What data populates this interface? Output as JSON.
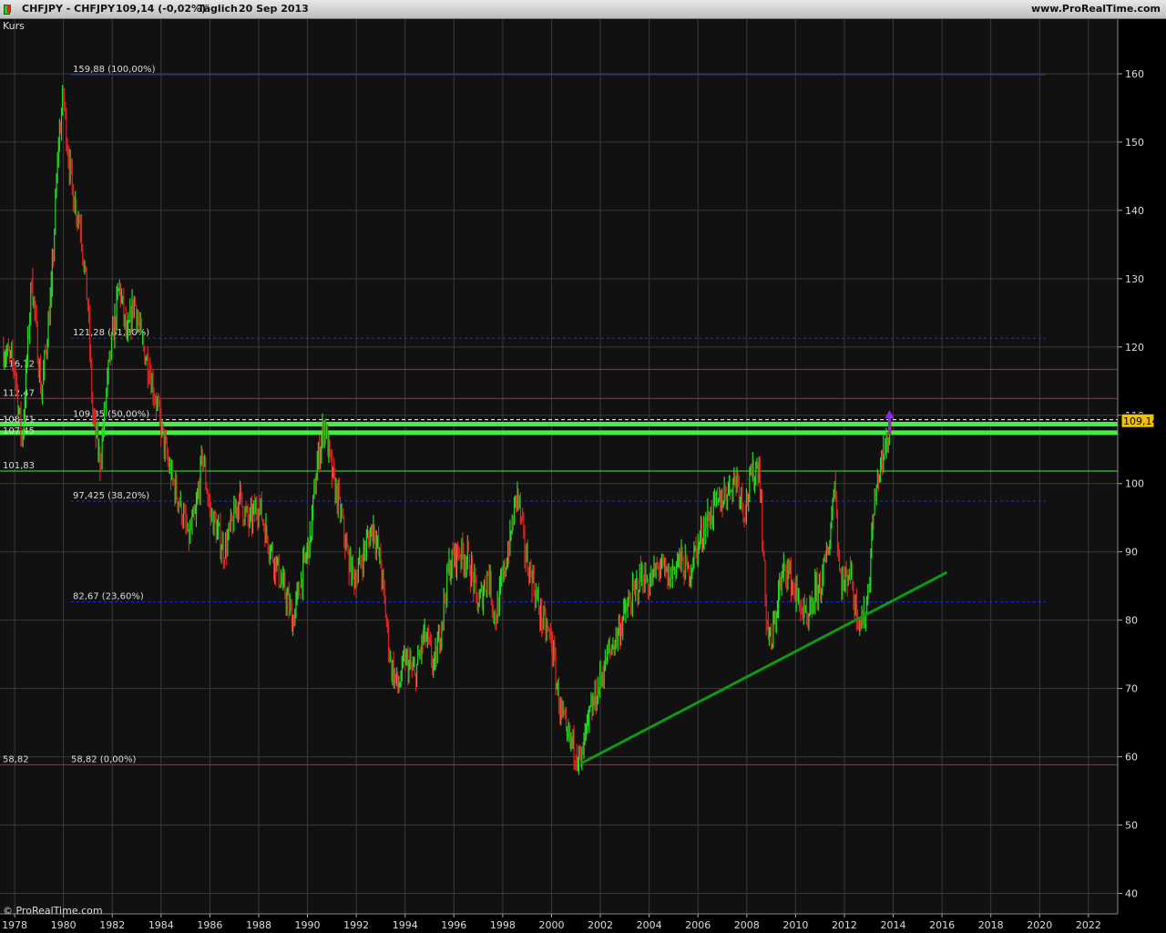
{
  "header": {
    "instrument": "CHFJPY - CHFJPY",
    "last_change": "109,14 (-0,02%)",
    "period": "Täglich",
    "date": "20 Sep 2013",
    "site": "www.ProRealTime.com"
  },
  "footer": {
    "copyright": "© ProRealTime.com"
  },
  "colors": {
    "background": "#111111",
    "up": "#22dd22",
    "down": "#dd2222",
    "fib": "#2233cc",
    "trend": "#119911",
    "resistance": "#44ee44",
    "price_box": "#f2c200"
  },
  "chart_data": {
    "type": "line",
    "title": "Kurs",
    "ylim": [
      37,
      168
    ],
    "xlim": [
      1977.4,
      2023.2
    ],
    "y_ticks": [
      40,
      50,
      60,
      70,
      80,
      90,
      100,
      110,
      120,
      130,
      140,
      150,
      160
    ],
    "x_ticks": [
      "1978",
      "1980",
      "1982",
      "1984",
      "1986",
      "1988",
      "1990",
      "1992",
      "1994",
      "1996",
      "1998",
      "2000",
      "2002",
      "2004",
      "2006",
      "2008",
      "2010",
      "2012",
      "2014",
      "2016",
      "2018",
      "2020",
      "2022"
    ],
    "last_price": {
      "value": 109.14,
      "label": "109,14"
    },
    "series": [
      {
        "values": [
          [
            1977.5,
            120
          ],
          [
            1978.0,
            117
          ],
          [
            1978.3,
            106
          ],
          [
            1978.7,
            130
          ],
          [
            1979.1,
            113
          ],
          [
            1979.5,
            128
          ],
          [
            1979.8,
            150
          ],
          [
            1980.0,
            157
          ],
          [
            1980.2,
            148
          ],
          [
            1980.4,
            142
          ],
          [
            1980.7,
            138
          ],
          [
            1981.0,
            126
          ],
          [
            1981.2,
            110
          ],
          [
            1981.5,
            103
          ],
          [
            1981.8,
            115
          ],
          [
            1982.1,
            124
          ],
          [
            1982.3,
            129
          ],
          [
            1982.6,
            121
          ],
          [
            1982.9,
            127
          ],
          [
            1983.2,
            121
          ],
          [
            1983.5,
            117
          ],
          [
            1983.8,
            112
          ],
          [
            1984.0,
            108
          ],
          [
            1984.4,
            101
          ],
          [
            1984.8,
            97
          ],
          [
            1985.1,
            92
          ],
          [
            1985.4,
            95
          ],
          [
            1985.7,
            104
          ],
          [
            1986.0,
            96
          ],
          [
            1986.3,
            93
          ],
          [
            1986.6,
            90
          ],
          [
            1986.9,
            94
          ],
          [
            1987.2,
            98
          ],
          [
            1987.6,
            94
          ],
          [
            1988.0,
            97
          ],
          [
            1988.3,
            93
          ],
          [
            1988.7,
            88
          ],
          [
            1989.0,
            85
          ],
          [
            1989.4,
            80
          ],
          [
            1989.7,
            85
          ],
          [
            1990.1,
            92
          ],
          [
            1990.4,
            103
          ],
          [
            1990.7,
            109
          ],
          [
            1991.0,
            101
          ],
          [
            1991.3,
            97
          ],
          [
            1991.7,
            88
          ],
          [
            1992.0,
            86
          ],
          [
            1992.3,
            90
          ],
          [
            1992.7,
            94
          ],
          [
            1993.0,
            88
          ],
          [
            1993.4,
            74
          ],
          [
            1993.7,
            70
          ],
          [
            1994.0,
            74
          ],
          [
            1994.4,
            72
          ],
          [
            1994.8,
            78
          ],
          [
            1995.2,
            73
          ],
          [
            1995.5,
            80
          ],
          [
            1995.8,
            88
          ],
          [
            1996.2,
            90
          ],
          [
            1996.6,
            89
          ],
          [
            1997.0,
            82
          ],
          [
            1997.4,
            87
          ],
          [
            1997.7,
            80
          ],
          [
            1998.0,
            86
          ],
          [
            1998.3,
            92
          ],
          [
            1998.6,
            99
          ],
          [
            1998.9,
            90
          ],
          [
            1999.2,
            86
          ],
          [
            1999.6,
            80
          ],
          [
            2000.0,
            77
          ],
          [
            2000.3,
            68
          ],
          [
            2000.6,
            63
          ],
          [
            2001.0,
            61
          ],
          [
            2001.2,
            59
          ],
          [
            2001.5,
            65
          ],
          [
            2001.9,
            70
          ],
          [
            2002.2,
            74
          ],
          [
            2002.6,
            77
          ],
          [
            2003.0,
            81
          ],
          [
            2003.4,
            84
          ],
          [
            2003.7,
            87
          ],
          [
            2004.0,
            85
          ],
          [
            2004.4,
            88
          ],
          [
            2004.8,
            86
          ],
          [
            2005.2,
            89
          ],
          [
            2005.6,
            87
          ],
          [
            2006.0,
            91
          ],
          [
            2006.4,
            95
          ],
          [
            2006.8,
            97
          ],
          [
            2007.2,
            99
          ],
          [
            2007.6,
            101
          ],
          [
            2007.9,
            96
          ],
          [
            2008.2,
            101
          ],
          [
            2008.5,
            103
          ],
          [
            2008.8,
            80
          ],
          [
            2009.0,
            76
          ],
          [
            2009.3,
            84
          ],
          [
            2009.6,
            88
          ],
          [
            2009.9,
            85
          ],
          [
            2010.2,
            82
          ],
          [
            2010.5,
            79
          ],
          [
            2010.8,
            84
          ],
          [
            2011.1,
            86
          ],
          [
            2011.4,
            92
          ],
          [
            2011.6,
            101
          ],
          [
            2011.8,
            87
          ],
          [
            2012.0,
            85
          ],
          [
            2012.2,
            88
          ],
          [
            2012.5,
            81
          ],
          [
            2012.8,
            80
          ],
          [
            2013.0,
            85
          ],
          [
            2013.2,
            96
          ],
          [
            2013.4,
            101
          ],
          [
            2013.6,
            104
          ],
          [
            2013.8,
            107
          ],
          [
            2013.9,
            109.14
          ]
        ]
      }
    ],
    "horizontal_levels": [
      {
        "value": 159.88,
        "label": "159,88 (100,00%)",
        "style": "fib"
      },
      {
        "value": 121.28,
        "label": "121,28 (61,80%)",
        "style": "fib-dashed"
      },
      {
        "value": 116.72,
        "label": "116,72",
        "style": "red"
      },
      {
        "value": 112.47,
        "label": "112,47",
        "style": "red"
      },
      {
        "value": 109.35,
        "label": "109,35 (50,00%)",
        "style": "white-dashed"
      },
      {
        "value": 108.71,
        "label": "108,71",
        "style": "green-thick"
      },
      {
        "value": 107.45,
        "label": "107,45",
        "style": "green-thick"
      },
      {
        "value": 101.83,
        "label": "101,83",
        "style": "green-thin"
      },
      {
        "value": 97.425,
        "label": "97,425 (38,20%)",
        "style": "fib-dashed"
      },
      {
        "value": 82.67,
        "label": "82,67 (23,60%)",
        "style": "fib-dashed"
      },
      {
        "value": 58.82,
        "label": "58,82 (0,00%)",
        "style": "red"
      }
    ],
    "trendline": {
      "from": [
        2001.2,
        59
      ],
      "to": [
        2016.2,
        87
      ]
    },
    "arrow": {
      "x": 2013.85,
      "from": 107.2,
      "to": 110.5
    },
    "grid": true
  }
}
